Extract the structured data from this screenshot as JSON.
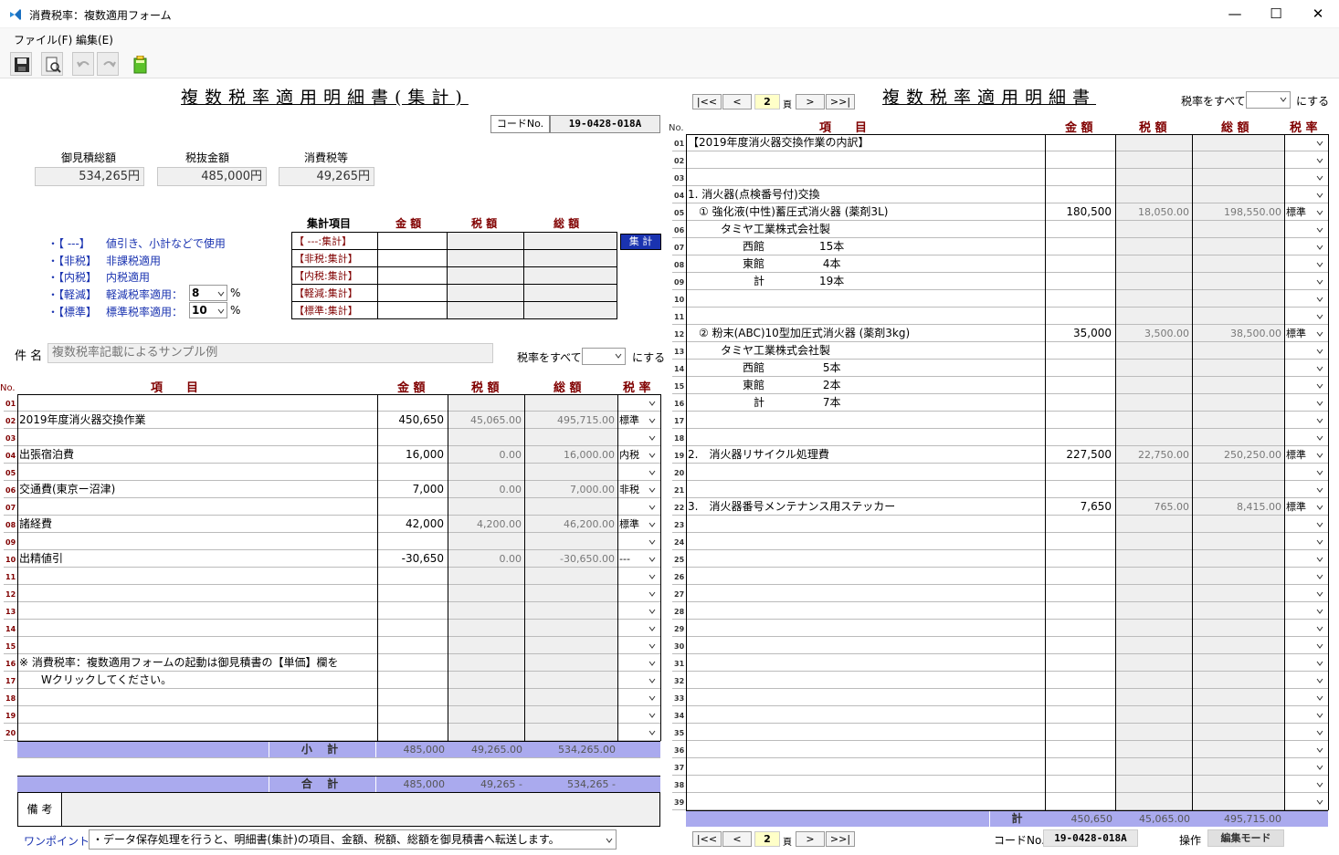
{
  "window": {
    "title": "消費税率：複数適用フォーム",
    "buttons": {
      "minimize": "—",
      "maximize": "☐",
      "close": "✕"
    }
  },
  "menu": {
    "file": "ファイル(F)",
    "edit": "編集(E)"
  },
  "left": {
    "title": "複数税率適用明細書(集計)",
    "code_label": "コードNo.",
    "code_value": "19-0428-018A",
    "totals": {
      "estimate_label": "御見積総額",
      "estimate_value": "534,265円",
      "pretax_label": "税抜金額",
      "pretax_value": "485,000円",
      "tax_label": "消費税等",
      "tax_value": "49,265円"
    },
    "legend": [
      {
        "tag": "・【 ---】",
        "desc": "値引き、小計などで使用"
      },
      {
        "tag": "・【非税】",
        "desc": "非課税適用"
      },
      {
        "tag": "・【内税】",
        "desc": "内税適用"
      },
      {
        "tag": "・【軽減】",
        "desc": "軽減税率適用：",
        "rate": "8",
        "unit": "%"
      },
      {
        "tag": "・【標準】",
        "desc": "標準税率適用：",
        "rate": "10",
        "unit": "%"
      }
    ],
    "summary_headers": {
      "item": "集計項目",
      "amount": "金 額",
      "tax": "税 額",
      "total": "総 額"
    },
    "summary_rows": [
      "【 ---:集計】",
      "【非税:集計】",
      "【内税:集計】",
      "【軽減:集計】",
      "【標準:集計】"
    ],
    "summary_button": "集 計",
    "subject_label": "件 名",
    "subject_value": "複数税率記載によるサンプル例",
    "rate_all_label": "税率をすべて",
    "rate_all_suffix": "にする",
    "headers": {
      "no": "No.",
      "item": "項　　目",
      "amount": "金 額",
      "tax": "税 額",
      "total": "総 額",
      "rate": "税 率"
    },
    "rows": [
      {
        "no": "01",
        "item": "",
        "amount": "",
        "tax": "",
        "total": "",
        "rate": ""
      },
      {
        "no": "02",
        "item": "2019年度消火器交換作業",
        "amount": "450,650",
        "tax": "45,065.00",
        "total": "495,715.00",
        "rate": "標準"
      },
      {
        "no": "03",
        "item": "",
        "amount": "",
        "tax": "",
        "total": "",
        "rate": ""
      },
      {
        "no": "04",
        "item": "出張宿泊費",
        "amount": "16,000",
        "tax": "0.00",
        "total": "16,000.00",
        "rate": "内税"
      },
      {
        "no": "05",
        "item": "",
        "amount": "",
        "tax": "",
        "total": "",
        "rate": ""
      },
      {
        "no": "06",
        "item": "交通費(東京ー沼津)",
        "amount": "7,000",
        "tax": "0.00",
        "total": "7,000.00",
        "rate": "非税"
      },
      {
        "no": "07",
        "item": "",
        "amount": "",
        "tax": "",
        "total": "",
        "rate": ""
      },
      {
        "no": "08",
        "item": "諸経費",
        "amount": "42,000",
        "tax": "4,200.00",
        "total": "46,200.00",
        "rate": "標準"
      },
      {
        "no": "09",
        "item": "",
        "amount": "",
        "tax": "",
        "total": "",
        "rate": ""
      },
      {
        "no": "10",
        "item": "出精値引",
        "amount": "-30,650",
        "tax": "0.00",
        "total": "-30,650.00",
        "rate": "---"
      },
      {
        "no": "11",
        "item": "",
        "amount": "",
        "tax": "",
        "total": "",
        "rate": ""
      },
      {
        "no": "12",
        "item": "",
        "amount": "",
        "tax": "",
        "total": "",
        "rate": ""
      },
      {
        "no": "13",
        "item": "",
        "amount": "",
        "tax": "",
        "total": "",
        "rate": ""
      },
      {
        "no": "14",
        "item": "",
        "amount": "",
        "tax": "",
        "total": "",
        "rate": ""
      },
      {
        "no": "15",
        "item": "",
        "amount": "",
        "tax": "",
        "total": "",
        "rate": ""
      },
      {
        "no": "16",
        "item": "※ 消費税率：複数適用フォームの起動は御見積書の【単価】欄を",
        "amount": "",
        "tax": "",
        "total": "",
        "rate": ""
      },
      {
        "no": "17",
        "item": "　　Wクリックしてください。",
        "amount": "",
        "tax": "",
        "total": "",
        "rate": ""
      },
      {
        "no": "18",
        "item": "",
        "amount": "",
        "tax": "",
        "total": "",
        "rate": ""
      },
      {
        "no": "19",
        "item": "",
        "amount": "",
        "tax": "",
        "total": "",
        "rate": ""
      },
      {
        "no": "20",
        "item": "",
        "amount": "",
        "tax": "",
        "total": "",
        "rate": ""
      }
    ],
    "subtotal": {
      "label": "小 計",
      "amount": "485,000",
      "tax": "49,265.00",
      "total": "534,265.00"
    },
    "grand_total": {
      "label": "合 計",
      "amount": "485,000",
      "tax": "49,265 -",
      "total": "534,265 -"
    },
    "remarks_label": "備 考",
    "onepoint_label": "ワンポイント:",
    "onepoint_value": "・データ保存処理を行うと、明細書(集計)の項目、金額、税額、総額を御見積書へ転送します。"
  },
  "right": {
    "title": "複数税率適用明細書",
    "nav": {
      "first": "|<<",
      "prev": "<",
      "page": "2",
      "page_unit": "頁",
      "next": ">",
      "last": ">>|"
    },
    "rate_all_label": "税率をすべて",
    "rate_all_suffix": "にする",
    "headers": {
      "no": "No.",
      "item": "項　　目",
      "amount": "金 額",
      "tax": "税 額",
      "total": "総 額",
      "rate": "税 率"
    },
    "rows": [
      {
        "no": "01",
        "item": "【2019年度消火器交換作業の内訳】",
        "amount": "",
        "tax": "",
        "total": "",
        "rate": ""
      },
      {
        "no": "02",
        "item": "",
        "amount": "",
        "tax": "",
        "total": "",
        "rate": ""
      },
      {
        "no": "03",
        "item": "",
        "amount": "",
        "tax": "",
        "total": "",
        "rate": ""
      },
      {
        "no": "04",
        "item": "1. 消火器(点検番号付)交換",
        "amount": "",
        "tax": "",
        "total": "",
        "rate": ""
      },
      {
        "no": "05",
        "item": "　① 強化液(中性)蓄圧式消火器 (薬剤3L)",
        "amount": "180,500",
        "tax": "18,050.00",
        "total": "198,550.00",
        "rate": "標準"
      },
      {
        "no": "06",
        "item": "　　　タミヤ工業株式会社製",
        "amount": "",
        "tax": "",
        "total": "",
        "rate": ""
      },
      {
        "no": "07",
        "item": "　　　　　西館　　　　　15本",
        "amount": "",
        "tax": "",
        "total": "",
        "rate": ""
      },
      {
        "no": "08",
        "item": "　　　　　東館　　　　　 4本",
        "amount": "",
        "tax": "",
        "total": "",
        "rate": ""
      },
      {
        "no": "09",
        "item": "　　　　　　計　　　　　19本",
        "amount": "",
        "tax": "",
        "total": "",
        "rate": ""
      },
      {
        "no": "10",
        "item": "",
        "amount": "",
        "tax": "",
        "total": "",
        "rate": ""
      },
      {
        "no": "11",
        "item": "",
        "amount": "",
        "tax": "",
        "total": "",
        "rate": ""
      },
      {
        "no": "12",
        "item": "　② 粉末(ABC)10型加圧式消火器 (薬剤3kg)",
        "amount": "35,000",
        "tax": "3,500.00",
        "total": "38,500.00",
        "rate": "標準"
      },
      {
        "no": "13",
        "item": "　　　タミヤ工業株式会社製",
        "amount": "",
        "tax": "",
        "total": "",
        "rate": ""
      },
      {
        "no": "14",
        "item": "　　　　　西館　　　　　 5本",
        "amount": "",
        "tax": "",
        "total": "",
        "rate": ""
      },
      {
        "no": "15",
        "item": "　　　　　東館　　　　　 2本",
        "amount": "",
        "tax": "",
        "total": "",
        "rate": ""
      },
      {
        "no": "16",
        "item": "　　　　　　計　　　　　 7本",
        "amount": "",
        "tax": "",
        "total": "",
        "rate": ""
      },
      {
        "no": "17",
        "item": "",
        "amount": "",
        "tax": "",
        "total": "",
        "rate": ""
      },
      {
        "no": "18",
        "item": "",
        "amount": "",
        "tax": "",
        "total": "",
        "rate": ""
      },
      {
        "no": "19",
        "item": "2.　消火器リサイクル処理費",
        "amount": "227,500",
        "tax": "22,750.00",
        "total": "250,250.00",
        "rate": "標準"
      },
      {
        "no": "20",
        "item": "",
        "amount": "",
        "tax": "",
        "total": "",
        "rate": ""
      },
      {
        "no": "21",
        "item": "",
        "amount": "",
        "tax": "",
        "total": "",
        "rate": ""
      },
      {
        "no": "22",
        "item": "3.　消火器番号メンテナンス用ステッカー",
        "amount": "7,650",
        "tax": "765.00",
        "total": "8,415.00",
        "rate": "標準"
      },
      {
        "no": "23",
        "item": "",
        "amount": "",
        "tax": "",
        "total": "",
        "rate": ""
      },
      {
        "no": "24",
        "item": "",
        "amount": "",
        "tax": "",
        "total": "",
        "rate": ""
      },
      {
        "no": "25",
        "item": "",
        "amount": "",
        "tax": "",
        "total": "",
        "rate": ""
      },
      {
        "no": "26",
        "item": "",
        "amount": "",
        "tax": "",
        "total": "",
        "rate": ""
      },
      {
        "no": "27",
        "item": "",
        "amount": "",
        "tax": "",
        "total": "",
        "rate": ""
      },
      {
        "no": "28",
        "item": "",
        "amount": "",
        "tax": "",
        "total": "",
        "rate": ""
      },
      {
        "no": "29",
        "item": "",
        "amount": "",
        "tax": "",
        "total": "",
        "rate": ""
      },
      {
        "no": "30",
        "item": "",
        "amount": "",
        "tax": "",
        "total": "",
        "rate": ""
      },
      {
        "no": "31",
        "item": "",
        "amount": "",
        "tax": "",
        "total": "",
        "rate": ""
      },
      {
        "no": "32",
        "item": "",
        "amount": "",
        "tax": "",
        "total": "",
        "rate": ""
      },
      {
        "no": "33",
        "item": "",
        "amount": "",
        "tax": "",
        "total": "",
        "rate": ""
      },
      {
        "no": "34",
        "item": "",
        "amount": "",
        "tax": "",
        "total": "",
        "rate": ""
      },
      {
        "no": "35",
        "item": "",
        "amount": "",
        "tax": "",
        "total": "",
        "rate": ""
      },
      {
        "no": "36",
        "item": "",
        "amount": "",
        "tax": "",
        "total": "",
        "rate": ""
      },
      {
        "no": "37",
        "item": "",
        "amount": "",
        "tax": "",
        "total": "",
        "rate": ""
      },
      {
        "no": "38",
        "item": "",
        "amount": "",
        "tax": "",
        "total": "",
        "rate": ""
      },
      {
        "no": "39",
        "item": "",
        "amount": "",
        "tax": "",
        "total": "",
        "rate": ""
      }
    ],
    "total": {
      "label": "計",
      "amount": "450,650",
      "tax": "45,065.00",
      "total": "495,715.00"
    },
    "code_label": "コードNo.",
    "code_value": "19-0428-018A",
    "op_label": "操作",
    "op_value": "編集モード"
  },
  "colors": {
    "sumbar": "#aaaaee",
    "row_no": "#800000",
    "legend": "#1a33b0",
    "shade": "#efefef"
  }
}
